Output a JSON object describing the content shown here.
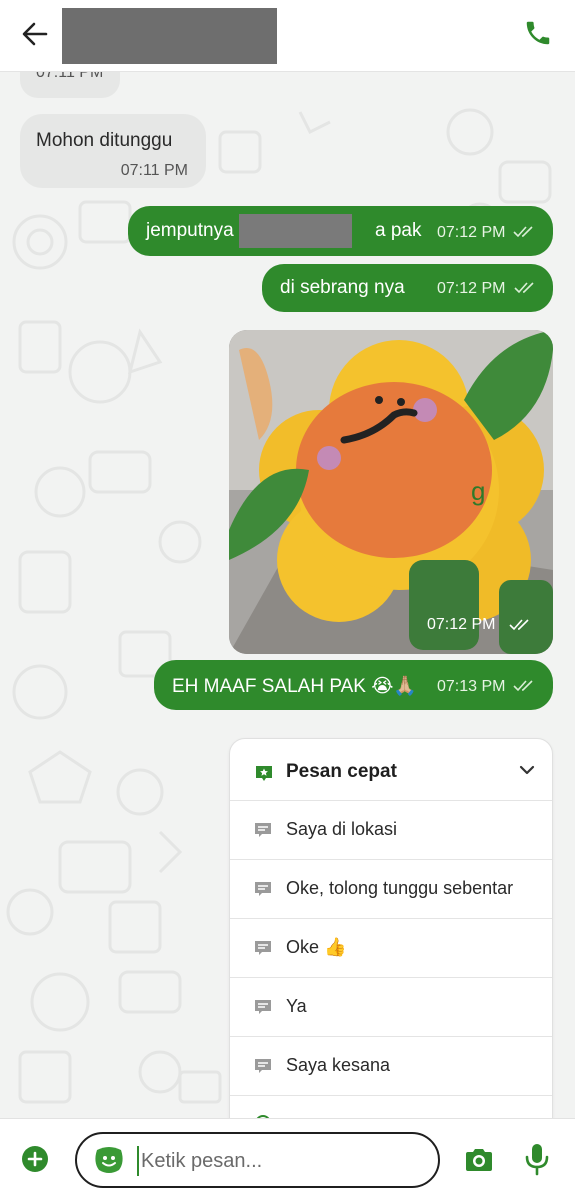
{
  "colors": {
    "accent": "#2f8a2c",
    "incoming_bubble": "#e6e7e6",
    "outgoing_bubble": "#2f8a2c",
    "background": "#f2f3f2"
  },
  "header": {
    "back_icon": "arrow-left-icon",
    "contact_name": "",
    "call_icon": "phone-icon"
  },
  "messages": [
    {
      "direction": "in",
      "text": "",
      "time": "07:11 PM"
    },
    {
      "direction": "in",
      "text": "Mohon ditunggu",
      "time": "07:11 PM"
    },
    {
      "direction": "out",
      "text": "jemputnya",
      "text_end": "a pak",
      "time": "07:12 PM",
      "status_icon": "double-check-icon"
    },
    {
      "direction": "out",
      "text": "di sebrang nya",
      "time": "07:12 PM",
      "status_icon": "double-check-icon"
    },
    {
      "direction": "out",
      "type": "image",
      "time": "07:12 PM",
      "status_icon": "double-check-icon"
    },
    {
      "direction": "out",
      "text": "EH MAAF SALAH PAK 😭🙏🏼",
      "time": "07:13 PM",
      "status_icon": "double-check-icon"
    }
  ],
  "quick_replies": {
    "title": "Pesan cepat",
    "icon": "star-tag-icon",
    "toggle_icon": "chevron-down-icon",
    "items": [
      {
        "label": "Saya di lokasi"
      },
      {
        "label": "Oke, tolong tunggu sebentar"
      },
      {
        "label": "Oke 👍"
      },
      {
        "label": "Ya"
      },
      {
        "label": "Saya kesana"
      }
    ]
  },
  "input_bar": {
    "attach_icon": "plus-circle-icon",
    "sticker_icon": "sticker-face-icon",
    "placeholder": "Ketik pesan...",
    "camera_icon": "camera-icon",
    "mic_icon": "microphone-icon"
  }
}
